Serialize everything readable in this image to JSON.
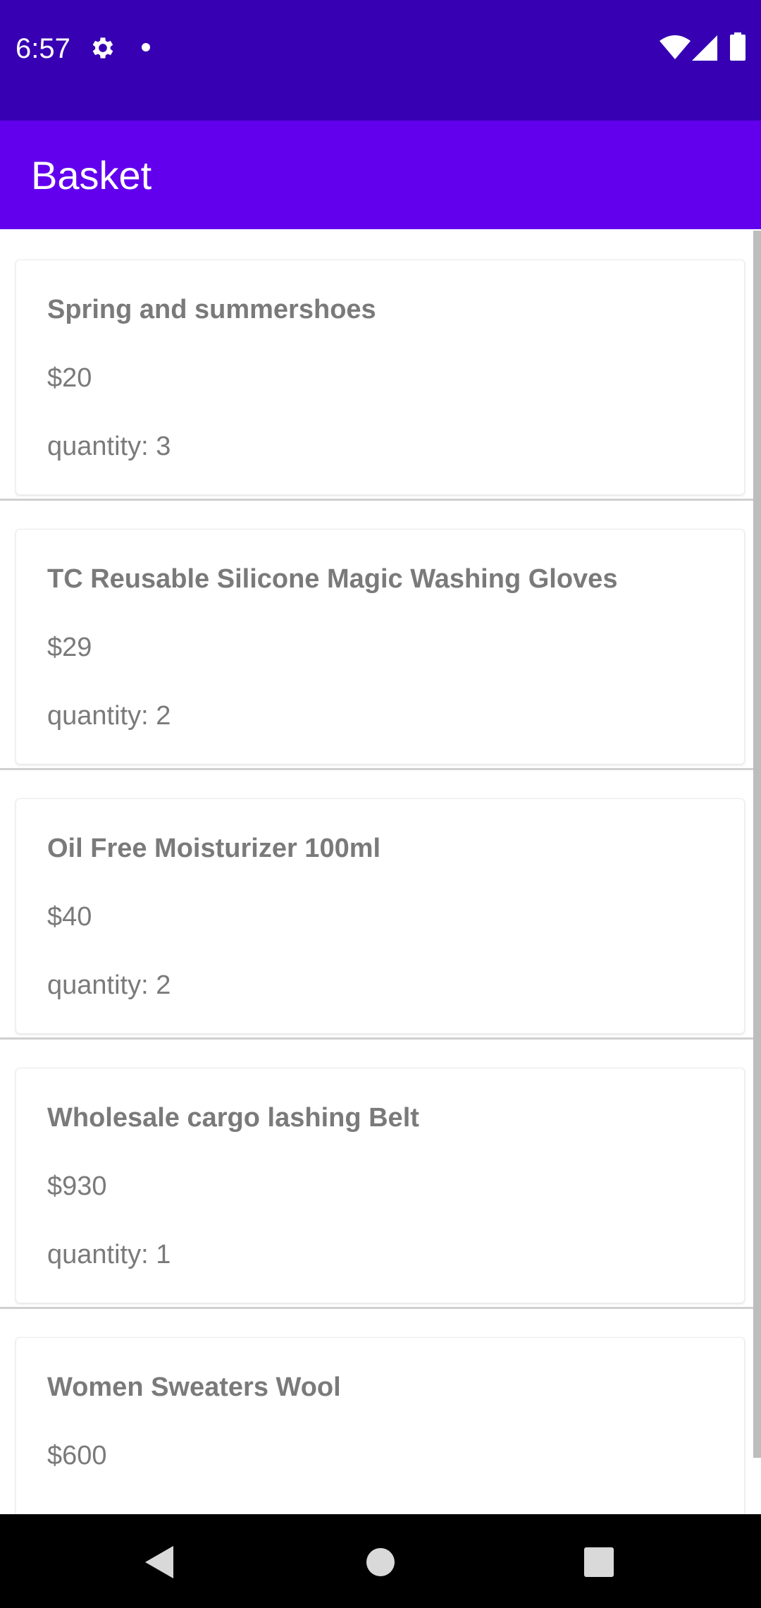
{
  "status_bar": {
    "time": "6:57",
    "icons": [
      "gear-icon",
      "dot-icon",
      "wifi-icon",
      "cellular-signal-icon",
      "battery-icon"
    ]
  },
  "app_bar": {
    "title": "Basket"
  },
  "basket": {
    "items": [
      {
        "name": "Spring and summershoes",
        "price": "$20",
        "quantity": "quantity: 3"
      },
      {
        "name": "TC Reusable Silicone Magic Washing Gloves",
        "price": "$29",
        "quantity": "quantity: 2"
      },
      {
        "name": "Oil Free Moisturizer 100ml",
        "price": "$40",
        "quantity": "quantity: 2"
      },
      {
        "name": "Wholesale cargo lashing Belt",
        "price": "$930",
        "quantity": "quantity: 1"
      },
      {
        "name": "Women Sweaters Wool",
        "price": "$600",
        "quantity": ""
      }
    ]
  },
  "nav_bar": {
    "icons": [
      "back-icon",
      "home-icon",
      "recents-icon"
    ]
  },
  "colors": {
    "status_bar": "#3700b3",
    "app_bar": "#6200ee",
    "item_text": "#7a7a7a"
  }
}
